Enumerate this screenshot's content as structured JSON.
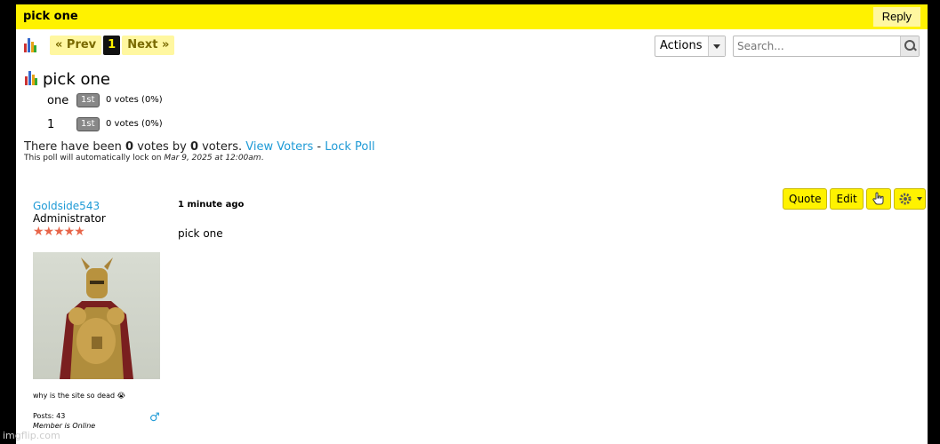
{
  "topic": {
    "title": "pick one",
    "reply_label": "Reply"
  },
  "pager": {
    "prev_label": "« Prev",
    "current": "1",
    "next_label": "Next »"
  },
  "actions": {
    "label": "Actions"
  },
  "search": {
    "placeholder": "Search..."
  },
  "poll": {
    "title": "pick one",
    "options": [
      {
        "label": "one",
        "badge": "1st",
        "votes": "0 votes (0%)"
      },
      {
        "label": "1",
        "badge": "1st",
        "votes": "0 votes (0%)"
      }
    ],
    "summary_prefix": "There have been ",
    "votes_count": "0",
    "summary_mid": " votes by ",
    "voters_count": "0",
    "summary_suffix": " voters. ",
    "view_voters": "View Voters",
    "separator": " - ",
    "lock_poll": "Lock Poll",
    "lock_prefix": "This poll will automatically lock on ",
    "lock_date": "Mar 9, 2025 at 12:00am",
    "lock_suffix": "."
  },
  "post": {
    "username": "Goldside543",
    "rank": "Administrator",
    "time_ago": "1 minute ago",
    "body": "pick one",
    "signature": "why is the site so dead 😭",
    "posts": "Posts: 43",
    "status": "Member is Online",
    "buttons": {
      "quote": "Quote",
      "edit": "Edit"
    }
  },
  "watermark": "imgflip.com",
  "colors": {
    "accent": "#fff200",
    "link": "#1e9ad6"
  }
}
